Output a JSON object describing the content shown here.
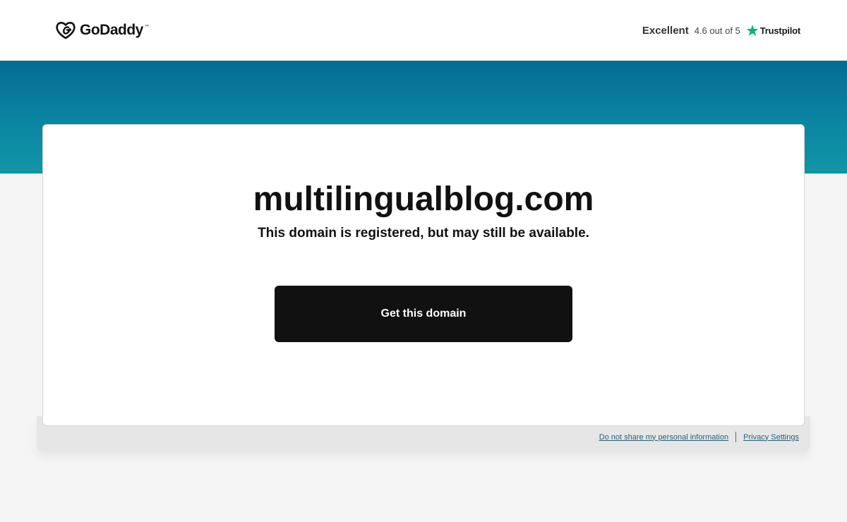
{
  "header": {
    "logo_text": "GoDaddy",
    "logo_tm": "™",
    "rating": {
      "label": "Excellent",
      "score": "4.6 out of 5",
      "provider": "Trustpilot"
    }
  },
  "colors": {
    "band_top": "#066b94",
    "band_bottom": "#1195a6",
    "button_bg": "#111111",
    "trustpilot_green": "#00b67a",
    "link": "#2a5f7a"
  },
  "icons": {
    "logo": "godaddy-heart-icon",
    "rating": "trustpilot-star-icon"
  },
  "main": {
    "domain": "multilingualblog.com",
    "subtitle": "This domain is registered, but may still be available.",
    "cta_label": "Get this domain"
  },
  "footer": {
    "links": [
      "Do not share my personal information",
      "Privacy Settings"
    ]
  }
}
